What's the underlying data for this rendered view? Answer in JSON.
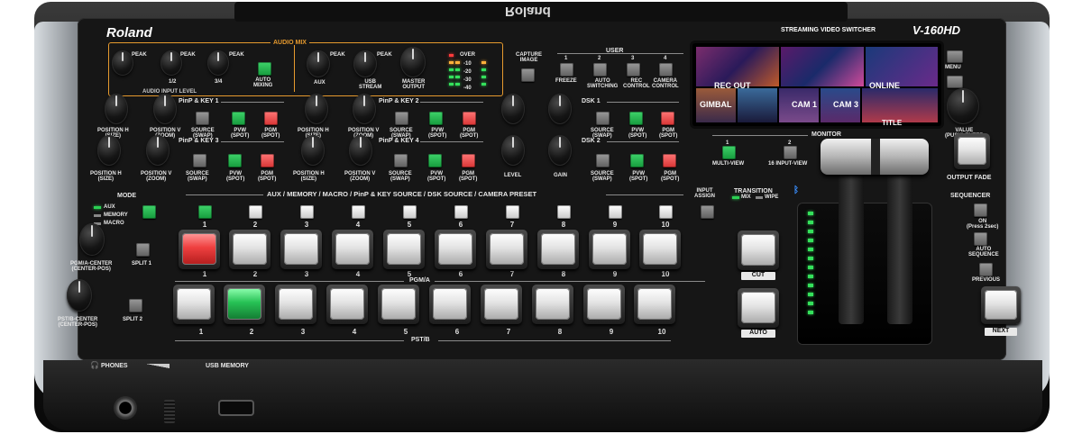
{
  "brand": {
    "logo": "Roland",
    "top_reversed_logo": "Roland",
    "model_name": "STREAMING VIDEO SWITCHER",
    "model_number": "V-160HD"
  },
  "audio": {
    "section": "AUDIO MIX",
    "input_level": "AUDIO INPUT LEVEL",
    "peak": "PEAK",
    "knob_labels": [
      "1/2",
      "3/4"
    ],
    "auto_mixing": "AUTO\nMIXING",
    "aux": "AUX",
    "usb_stream": "USB\nSTREAM",
    "master_output": "MASTER\nOUTPUT",
    "meter_labels": [
      "OVER",
      "-10",
      "-20",
      "-30",
      "-40"
    ]
  },
  "pinp": [
    {
      "title": "PinP & KEY 1",
      "pos_h": "POSITION H\n(SIZE)",
      "pos_v": "POSITION V\n(ZOOM)",
      "source": "SOURCE\n(SWAP)",
      "pvw": "PVW\n(SPOT)",
      "pgm": "PGM\n(SPOT)"
    },
    {
      "title": "PinP & KEY 2",
      "pos_h": "POSITION H\n(SIZE)",
      "pos_v": "POSITION V\n(ZOOM)",
      "source": "SOURCE\n(SWAP)",
      "pvw": "PVW\n(SPOT)",
      "pgm": "PGM\n(SPOT)"
    },
    {
      "title": "PinP & KEY 3",
      "pos_h": "POSITION H\n(SIZE)",
      "pos_v": "POSITION V\n(ZOOM)",
      "source": "SOURCE\n(SWAP)",
      "pvw": "PVW\n(SPOT)",
      "pgm": "PGM\n(SPOT)"
    },
    {
      "title": "PinP & KEY 4",
      "pos_h": "POSITION H\n(SIZE)",
      "pos_v": "POSITION V\n(ZOOM)",
      "source": "SOURCE\n(SWAP)",
      "pvw": "PVW\n(SPOT)",
      "pgm": "PGM\n(SPOT)"
    }
  ],
  "dsk": [
    {
      "title": "DSK 1",
      "level": "LEVEL",
      "gain": "GAIN",
      "source": "SOURCE\n(SWAP)",
      "pvw": "PVW\n(SPOT)",
      "pgm": "PGM\n(SPOT)"
    },
    {
      "title": "DSK 2",
      "level": "LEVEL",
      "gain": "GAIN",
      "source": "SOURCE\n(SWAP)",
      "pvw": "PVW\n(SPOT)",
      "pgm": "PGM\n(SPOT)"
    }
  ],
  "capture": "CAPTURE\nIMAGE",
  "user": {
    "title": "USER",
    "nums": [
      "1",
      "2",
      "3",
      "4"
    ],
    "labels": [
      "FREEZE",
      "AUTO\nSWITCHING",
      "REC\nCONTROL",
      "CAMERA\nCONTROL"
    ]
  },
  "screen": {
    "tiles": [
      "REC OUT",
      "ONLINE",
      "GIMBAL",
      "CAM 1",
      "CAM 3",
      "TITLE"
    ]
  },
  "monitor": {
    "title": "MONITOR",
    "nums": [
      "1",
      "2"
    ],
    "labels": [
      "MULTI-VIEW",
      "16 INPUT-VIEW"
    ]
  },
  "menu": "MENU",
  "value": "VALUE\n(PUSH) ENTER",
  "output_fade": "OUTPUT FADE",
  "mode": {
    "title": "MODE",
    "items": [
      "AUX",
      "MEMORY",
      "MACRO"
    ],
    "pgm_center": "PGM/A-CENTER\n(CENTER-POS)",
    "pst_center": "PST/B-CENTER\n(CENTER-POS)",
    "split1": "SPLIT 1",
    "split2": "SPLIT 2"
  },
  "source_bar": "AUX / MEMORY / MACRO / PinP & KEY SOURCE / DSK SOURCE / CAMERA PRESET",
  "bus_numbers": [
    "1",
    "2",
    "3",
    "4",
    "5",
    "6",
    "7",
    "8",
    "9",
    "10"
  ],
  "pgm_label": "PGM/A",
  "pst_label": "PST/B",
  "input_assign": "INPUT\nASSIGN",
  "transition": {
    "title": "TRANSITION",
    "mix": "MIX",
    "wipe": "WIPE",
    "cut": "CUT",
    "auto": "AUTO"
  },
  "bluetooth_icon": "bluetooth-icon",
  "sequencer": {
    "title": "SEQUENCER",
    "on": "ON\n(Press 2sec)",
    "auto": "AUTO\nSEQUENCE",
    "previous": "PREVIOUS",
    "next": "NEXT"
  },
  "front": {
    "phones": "PHONES",
    "usb_memory": "USB MEMORY"
  },
  "colors": {
    "panel": "#1b1b1b",
    "chassis": "#b8bdc2",
    "accent_orange": "#e69a2e",
    "green": "#22b14c",
    "red": "#e33b3b"
  },
  "state": {
    "pgm_selected": 1,
    "pst_selected": 2
  }
}
